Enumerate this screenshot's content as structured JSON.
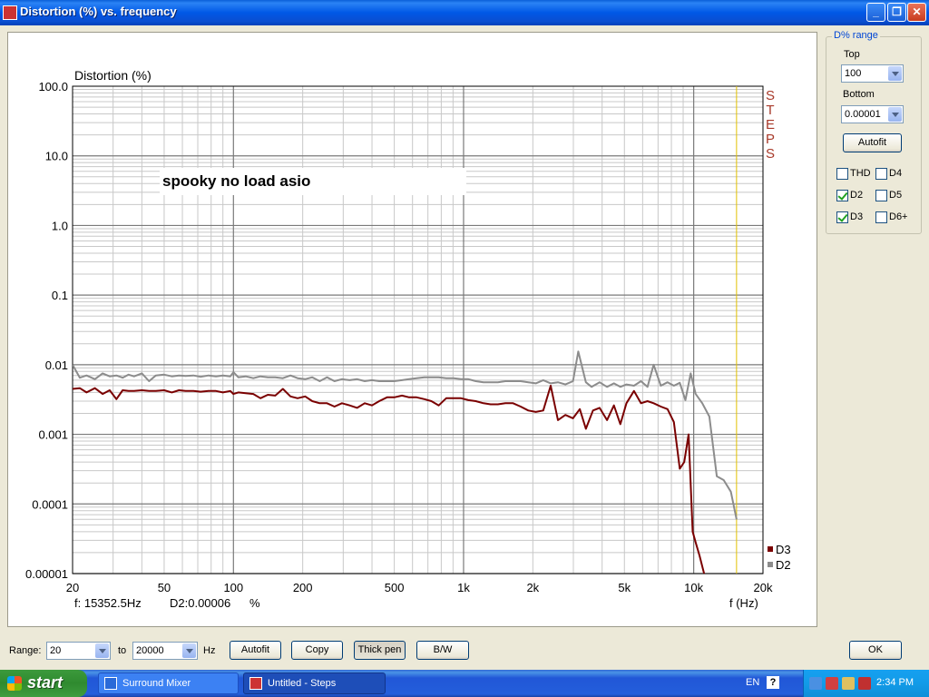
{
  "window": {
    "title": "Distortion (%) vs. frequency"
  },
  "chart_data": {
    "type": "line",
    "y_title": "Distortion (%)",
    "x_label": "f (Hz)",
    "annotation": "spooky no load asio",
    "side_label": "STEPS",
    "cursor_readout": {
      "freq": "f:  15352.5Hz",
      "value": "D2:0.00006",
      "unit": "%"
    },
    "x_scale": "log",
    "y_scale": "log",
    "xlim": [
      20,
      20000
    ],
    "ylim": [
      1e-05,
      100
    ],
    "grid": true,
    "legend_position": "bottom-right",
    "x_ticks": [
      {
        "v": 20,
        "l": "20"
      },
      {
        "v": 50,
        "l": "50"
      },
      {
        "v": 100,
        "l": "100"
      },
      {
        "v": 200,
        "l": "200"
      },
      {
        "v": 500,
        "l": "500"
      },
      {
        "v": 1000,
        "l": "1k"
      },
      {
        "v": 2000,
        "l": "2k"
      },
      {
        "v": 5000,
        "l": "5k"
      },
      {
        "v": 10000,
        "l": "10k"
      },
      {
        "v": 20000,
        "l": "20k"
      }
    ],
    "y_ticks": [
      {
        "v": 100,
        "l": "100.0"
      },
      {
        "v": 10,
        "l": "10.0"
      },
      {
        "v": 1,
        "l": "1.0"
      },
      {
        "v": 0.1,
        "l": "0.1"
      },
      {
        "v": 0.01,
        "l": "0.01"
      },
      {
        "v": 0.001,
        "l": "0.001"
      },
      {
        "v": 0.0001,
        "l": "0.0001"
      },
      {
        "v": 1e-05,
        "l": "0.00001"
      }
    ],
    "cursor_freq": 15352.5,
    "series": [
      {
        "name": "D2",
        "color": "#8c8c8c",
        "x": [
          20,
          21.5,
          23,
          25,
          27,
          29,
          31,
          33,
          35,
          37,
          40,
          43,
          46,
          50,
          54,
          58,
          62,
          67,
          72,
          78,
          84,
          90,
          97,
          100,
          105,
          113,
          122,
          131,
          141,
          152,
          164,
          177,
          190,
          205,
          220,
          237,
          255,
          275,
          296,
          320,
          345,
          372,
          400,
          430,
          465,
          500,
          540,
          580,
          625,
          675,
          725,
          780,
          840,
          905,
          975,
          1050,
          1130,
          1220,
          1310,
          1410,
          1520,
          1640,
          1770,
          1910,
          2060,
          2220,
          2390,
          2570,
          2770,
          2990,
          3150,
          3400,
          3600,
          3900,
          4200,
          4500,
          4800,
          5100,
          5500,
          5900,
          6300,
          6700,
          7200,
          7700,
          8200,
          8700,
          9200,
          9700,
          10200,
          10900,
          11700,
          12600,
          13500,
          14500,
          15352
        ],
        "y": [
          0.01,
          0.0065,
          0.007,
          0.0062,
          0.0075,
          0.0068,
          0.007,
          0.0065,
          0.0072,
          0.0068,
          0.0075,
          0.0058,
          0.007,
          0.0072,
          0.0068,
          0.007,
          0.0069,
          0.007,
          0.0067,
          0.007,
          0.0068,
          0.007,
          0.0068,
          0.0078,
          0.0066,
          0.0068,
          0.0064,
          0.0068,
          0.0066,
          0.0066,
          0.0064,
          0.007,
          0.0064,
          0.0062,
          0.0066,
          0.0058,
          0.0066,
          0.0058,
          0.0062,
          0.006,
          0.0062,
          0.0058,
          0.006,
          0.0058,
          0.0058,
          0.0058,
          0.006,
          0.0062,
          0.0064,
          0.0066,
          0.0066,
          0.0066,
          0.0064,
          0.0064,
          0.0062,
          0.0062,
          0.0058,
          0.0056,
          0.0056,
          0.0056,
          0.0058,
          0.0058,
          0.0058,
          0.0056,
          0.0054,
          0.006,
          0.0054,
          0.0056,
          0.0052,
          0.0058,
          0.0155,
          0.0056,
          0.0048,
          0.0056,
          0.0048,
          0.0054,
          0.0048,
          0.0052,
          0.005,
          0.0058,
          0.0048,
          0.01,
          0.005,
          0.0056,
          0.005,
          0.0055,
          0.0031,
          0.0075,
          0.0038,
          0.0028,
          0.0018,
          0.00025,
          0.00022,
          0.00015,
          6e-05
        ]
      },
      {
        "name": "D3",
        "color": "#7a0000",
        "x": [
          20,
          21.5,
          23,
          25,
          27,
          29,
          31,
          33,
          35,
          37,
          40,
          43,
          46,
          50,
          54,
          58,
          62,
          67,
          72,
          78,
          84,
          90,
          97,
          100,
          105,
          113,
          122,
          131,
          141,
          152,
          164,
          177,
          190,
          205,
          220,
          237,
          255,
          275,
          296,
          320,
          345,
          372,
          400,
          430,
          465,
          500,
          540,
          580,
          625,
          675,
          725,
          780,
          840,
          905,
          975,
          1050,
          1130,
          1220,
          1310,
          1410,
          1520,
          1640,
          1770,
          1910,
          2060,
          2220,
          2390,
          2570,
          2770,
          2990,
          3200,
          3400,
          3650,
          3900,
          4200,
          4500,
          4800,
          5100,
          5500,
          5900,
          6300,
          6700,
          7200,
          7700,
          8200,
          8700,
          9100,
          9500,
          9900,
          10200,
          10600,
          11100,
          11600,
          12000
        ],
        "y": [
          0.0045,
          0.0046,
          0.004,
          0.0046,
          0.0038,
          0.0043,
          0.0032,
          0.0043,
          0.0042,
          0.0042,
          0.0043,
          0.0042,
          0.0042,
          0.0043,
          0.004,
          0.0043,
          0.0042,
          0.0042,
          0.0041,
          0.0042,
          0.0042,
          0.004,
          0.0042,
          0.0038,
          0.004,
          0.0039,
          0.0038,
          0.0033,
          0.0037,
          0.0036,
          0.0045,
          0.0035,
          0.0033,
          0.0035,
          0.003,
          0.0028,
          0.0028,
          0.0025,
          0.0028,
          0.0026,
          0.0024,
          0.0028,
          0.0026,
          0.003,
          0.0034,
          0.0034,
          0.0036,
          0.0034,
          0.0034,
          0.0032,
          0.003,
          0.0026,
          0.0033,
          0.0033,
          0.0033,
          0.0031,
          0.003,
          0.0028,
          0.0027,
          0.0027,
          0.0028,
          0.0028,
          0.0025,
          0.0022,
          0.0021,
          0.0022,
          0.005,
          0.0016,
          0.0019,
          0.0017,
          0.0023,
          0.0012,
          0.0022,
          0.0024,
          0.0016,
          0.0026,
          0.0014,
          0.0028,
          0.0042,
          0.0028,
          0.003,
          0.0028,
          0.0025,
          0.0023,
          0.0015,
          0.00032,
          0.0004,
          0.001,
          4e-05,
          2.8e-05,
          1.8e-05,
          1e-05,
          5e-06,
          1e-07
        ]
      }
    ]
  },
  "range_panel": {
    "group_title": "D% range",
    "top_label": "Top",
    "top_value": "100",
    "bottom_label": "Bottom",
    "bottom_value": "0.00001",
    "autofit": "Autofit",
    "checks": [
      {
        "label": "THD",
        "checked": false
      },
      {
        "label": "D4",
        "checked": false
      },
      {
        "label": "D2",
        "checked": true
      },
      {
        "label": "D5",
        "checked": false
      },
      {
        "label": "D3",
        "checked": true
      },
      {
        "label": "D6+",
        "checked": false
      }
    ]
  },
  "bottom_bar": {
    "range_label": "Range:",
    "from_value": "20",
    "to_label": "to",
    "to_value": "20000",
    "unit": "Hz",
    "autofit": "Autofit",
    "copy": "Copy",
    "thick_pen": "Thick pen",
    "bw": "B/W",
    "ok": "OK"
  },
  "taskbar": {
    "start": "start",
    "tasks": [
      "Surround Mixer",
      "Untitled - Steps"
    ],
    "lang": "EN",
    "help": "?",
    "clock": "2:34 PM"
  }
}
